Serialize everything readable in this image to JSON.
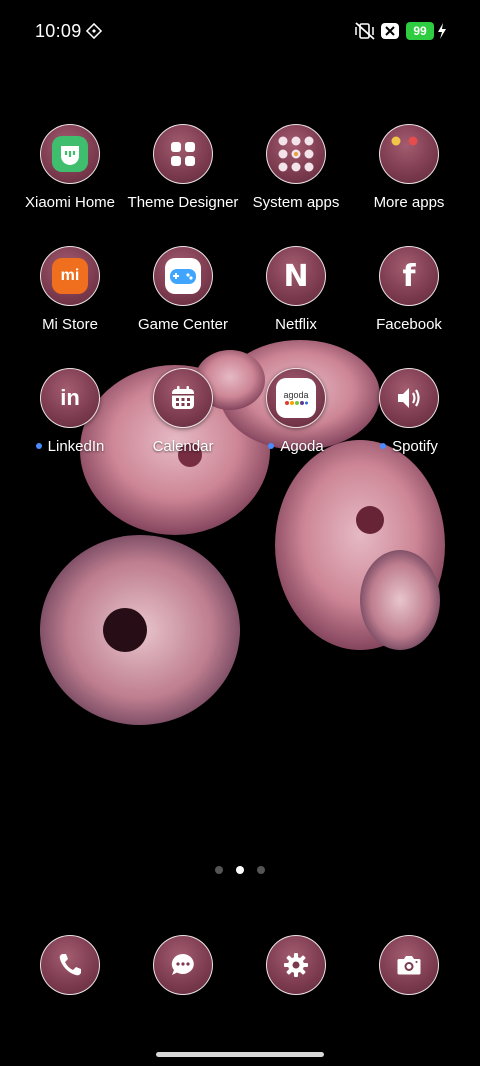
{
  "status_bar": {
    "time": "10:09",
    "battery_level": "99",
    "icons": [
      "diamond-sync-icon",
      "vibrate-off-icon",
      "close-box-icon",
      "battery-icon",
      "charging-bolt-icon"
    ]
  },
  "apps": [
    {
      "label": "Xiaomi Home",
      "icon": "xiaomi-home-icon",
      "new": false
    },
    {
      "label": "Theme Designer",
      "icon": "theme-designer-icon",
      "new": false
    },
    {
      "label": "System apps",
      "icon": "folder-icon",
      "new": false
    },
    {
      "label": "More apps",
      "icon": "folder-icon",
      "new": false
    },
    {
      "label": "Mi Store",
      "icon": "mi-store-icon",
      "new": false
    },
    {
      "label": "Game Center",
      "icon": "game-center-icon",
      "new": false
    },
    {
      "label": "Netflix",
      "icon": "netflix-icon",
      "new": false
    },
    {
      "label": "Facebook",
      "icon": "facebook-icon",
      "new": false
    },
    {
      "label": "LinkedIn",
      "icon": "linkedin-icon",
      "new": true
    },
    {
      "label": "Calendar",
      "icon": "calendar-icon",
      "new": false
    },
    {
      "label": "Agoda",
      "icon": "agoda-icon",
      "new": true,
      "logo_text": "agoda"
    },
    {
      "label": "Spotify",
      "icon": "spotify-icon",
      "new": true
    }
  ],
  "dock": [
    {
      "icon": "phone-icon"
    },
    {
      "icon": "messages-icon"
    },
    {
      "icon": "settings-icon"
    },
    {
      "icon": "camera-icon"
    }
  ],
  "page_indicator": {
    "pages": 3,
    "current": 2
  },
  "colors": {
    "icon_bg": "#7b3a4e",
    "battery": "#2ecc40",
    "new_dot": "#4a8cff"
  }
}
